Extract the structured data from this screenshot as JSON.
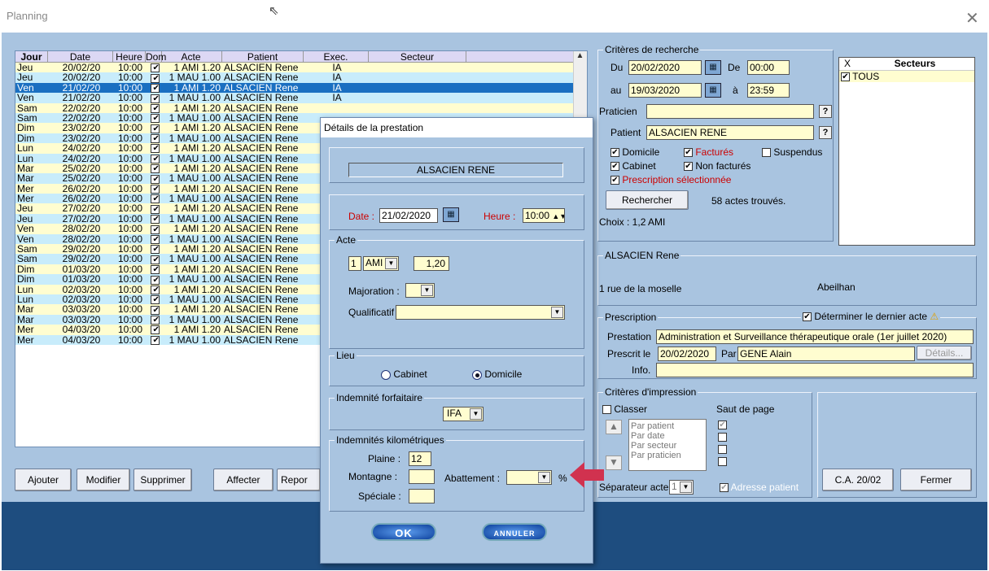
{
  "window": {
    "title": "Planning",
    "close_glyph": "✕"
  },
  "table": {
    "columns": [
      "Jour",
      "Date",
      "Heure",
      "Dom",
      "Acte",
      "Patient",
      "Exec.",
      "Secteur"
    ],
    "rows": [
      {
        "jour": "Jeu",
        "date": "20/02/20",
        "heure": "10:00",
        "dom": true,
        "acte": "1 AMI 1.20",
        "patient": "ALSACIEN Rene",
        "exec": "IA",
        "style": "yel"
      },
      {
        "jour": "Jeu",
        "date": "20/02/20",
        "heure": "10:00",
        "dom": true,
        "acte": "1 MAU 1.00",
        "patient": "ALSACIEN Rene",
        "exec": "IA",
        "style": "blu"
      },
      {
        "jour": "Ven",
        "date": "21/02/20",
        "heure": "10:00",
        "dom": true,
        "acte": "1 AMI 1.20",
        "patient": "ALSACIEN Rene",
        "exec": "IA",
        "style": "sel"
      },
      {
        "jour": "Ven",
        "date": "21/02/20",
        "heure": "10:00",
        "dom": true,
        "acte": "1 MAU 1.00",
        "patient": "ALSACIEN Rene",
        "exec": "IA",
        "style": "blu"
      },
      {
        "jour": "Sam",
        "date": "22/02/20",
        "heure": "10:00",
        "dom": true,
        "acte": "1 AMI 1.20",
        "patient": "ALSACIEN Rene",
        "exec": "",
        "style": "yel"
      },
      {
        "jour": "Sam",
        "date": "22/02/20",
        "heure": "10:00",
        "dom": true,
        "acte": "1 MAU 1.00",
        "patient": "ALSACIEN Rene",
        "exec": "",
        "style": "blu"
      },
      {
        "jour": "Dim",
        "date": "23/02/20",
        "heure": "10:00",
        "dom": true,
        "acte": "1 AMI 1.20",
        "patient": "ALSACIEN Rene",
        "exec": "",
        "style": "yel"
      },
      {
        "jour": "Dim",
        "date": "23/02/20",
        "heure": "10:00",
        "dom": true,
        "acte": "1 MAU 1.00",
        "patient": "ALSACIEN Rene",
        "exec": "",
        "style": "blu"
      },
      {
        "jour": "Lun",
        "date": "24/02/20",
        "heure": "10:00",
        "dom": true,
        "acte": "1 AMI 1.20",
        "patient": "ALSACIEN Rene",
        "exec": "",
        "style": "yel"
      },
      {
        "jour": "Lun",
        "date": "24/02/20",
        "heure": "10:00",
        "dom": true,
        "acte": "1 MAU 1.00",
        "patient": "ALSACIEN Rene",
        "exec": "",
        "style": "blu"
      },
      {
        "jour": "Mar",
        "date": "25/02/20",
        "heure": "10:00",
        "dom": true,
        "acte": "1 AMI 1.20",
        "patient": "ALSACIEN Rene",
        "exec": "",
        "style": "yel"
      },
      {
        "jour": "Mar",
        "date": "25/02/20",
        "heure": "10:00",
        "dom": true,
        "acte": "1 MAU 1.00",
        "patient": "ALSACIEN Rene",
        "exec": "",
        "style": "blu"
      },
      {
        "jour": "Mer",
        "date": "26/02/20",
        "heure": "10:00",
        "dom": true,
        "acte": "1 AMI 1.20",
        "patient": "ALSACIEN Rene",
        "exec": "",
        "style": "yel"
      },
      {
        "jour": "Mer",
        "date": "26/02/20",
        "heure": "10:00",
        "dom": true,
        "acte": "1 MAU 1.00",
        "patient": "ALSACIEN Rene",
        "exec": "",
        "style": "blu"
      },
      {
        "jour": "Jeu",
        "date": "27/02/20",
        "heure": "10:00",
        "dom": true,
        "acte": "1 AMI 1.20",
        "patient": "ALSACIEN Rene",
        "exec": "",
        "style": "yel"
      },
      {
        "jour": "Jeu",
        "date": "27/02/20",
        "heure": "10:00",
        "dom": true,
        "acte": "1 MAU 1.00",
        "patient": "ALSACIEN Rene",
        "exec": "",
        "style": "blu"
      },
      {
        "jour": "Ven",
        "date": "28/02/20",
        "heure": "10:00",
        "dom": true,
        "acte": "1 AMI 1.20",
        "patient": "ALSACIEN Rene",
        "exec": "",
        "style": "yel"
      },
      {
        "jour": "Ven",
        "date": "28/02/20",
        "heure": "10:00",
        "dom": true,
        "acte": "1 MAU 1.00",
        "patient": "ALSACIEN Rene",
        "exec": "",
        "style": "blu"
      },
      {
        "jour": "Sam",
        "date": "29/02/20",
        "heure": "10:00",
        "dom": true,
        "acte": "1 AMI 1.20",
        "patient": "ALSACIEN Rene",
        "exec": "",
        "style": "yel"
      },
      {
        "jour": "Sam",
        "date": "29/02/20",
        "heure": "10:00",
        "dom": true,
        "acte": "1 MAU 1.00",
        "patient": "ALSACIEN Rene",
        "exec": "",
        "style": "blu"
      },
      {
        "jour": "Dim",
        "date": "01/03/20",
        "heure": "10:00",
        "dom": true,
        "acte": "1 AMI 1.20",
        "patient": "ALSACIEN Rene",
        "exec": "",
        "style": "yel"
      },
      {
        "jour": "Dim",
        "date": "01/03/20",
        "heure": "10:00",
        "dom": true,
        "acte": "1 MAU 1.00",
        "patient": "ALSACIEN Rene",
        "exec": "",
        "style": "blu"
      },
      {
        "jour": "Lun",
        "date": "02/03/20",
        "heure": "10:00",
        "dom": true,
        "acte": "1 AMI 1.20",
        "patient": "ALSACIEN Rene",
        "exec": "",
        "style": "yel"
      },
      {
        "jour": "Lun",
        "date": "02/03/20",
        "heure": "10:00",
        "dom": true,
        "acte": "1 MAU 1.00",
        "patient": "ALSACIEN Rene",
        "exec": "",
        "style": "blu"
      },
      {
        "jour": "Mar",
        "date": "03/03/20",
        "heure": "10:00",
        "dom": true,
        "acte": "1 AMI 1.20",
        "patient": "ALSACIEN Rene",
        "exec": "",
        "style": "yel"
      },
      {
        "jour": "Mar",
        "date": "03/03/20",
        "heure": "10:00",
        "dom": true,
        "acte": "1 MAU 1.00",
        "patient": "ALSACIEN Rene",
        "exec": "",
        "style": "blu"
      },
      {
        "jour": "Mer",
        "date": "04/03/20",
        "heure": "10:00",
        "dom": true,
        "acte": "1 AMI 1.20",
        "patient": "ALSACIEN Rene",
        "exec": "",
        "style": "yel"
      },
      {
        "jour": "Mer",
        "date": "04/03/20",
        "heure": "10:00",
        "dom": true,
        "acte": "1 MAU 1.00",
        "patient": "ALSACIEN Rene",
        "exec": "",
        "style": "blu"
      }
    ]
  },
  "bottom_buttons": {
    "ajouter": "Ajouter",
    "modifier": "Modifier",
    "supprimer": "Supprimer",
    "affecter": "Affecter",
    "reporter": "Repor"
  },
  "criteria": {
    "legend": "Critères de recherche",
    "du_label": "Du",
    "du_value": "20/02/2020",
    "de_label": "De",
    "de_value": "00:00",
    "au_label": "au",
    "au_value": "19/03/2020",
    "a_label": "à",
    "a_value": "23:59",
    "praticien_label": "Praticien",
    "praticien_value": "",
    "patient_label": "Patient",
    "patient_value": "ALSACIEN RENE",
    "domicile": "Domicile",
    "factures": "Facturés",
    "suspendus": "Suspendus",
    "cabinet": "Cabinet",
    "non_factures": "Non facturés",
    "prescription_sel": "Prescription sélectionnée",
    "search_button": "Rechercher",
    "result": "58 actes trouvés.",
    "choix": "Choix : 1,2 AMI",
    "question": "?"
  },
  "secteurs": {
    "header_x": "X",
    "header": "Secteurs",
    "items": [
      "TOUS"
    ]
  },
  "patient_group": {
    "legend": "ALSACIEN Rene",
    "address": "1 rue de la moselle",
    "city": "Abeilhan"
  },
  "prescription": {
    "legend": "Prescription",
    "determiner": "Déterminer le dernier acte",
    "warn_icon": "⚠",
    "prestation_label": "Prestation",
    "prestation_value": "Administration et Surveillance thérapeutique orale (1er juillet 2020)",
    "prescrit_label": "Prescrit le",
    "prescrit_value": "20/02/2020",
    "par_label": "Par",
    "par_value": "GENE Alain",
    "details_button": "Détails...",
    "info_label": "Info.",
    "info_value": ""
  },
  "impression": {
    "legend": "Critères d'impression",
    "classer": "Classer",
    "saut": "Saut de page",
    "options": [
      "Par patient",
      "Par date",
      "Par secteur",
      "Par praticien"
    ],
    "separateur_label": "Séparateur acte",
    "separateur_value": "1",
    "adresse": "Adresse patient"
  },
  "right_buttons": {
    "ca": "C.A. 20/02",
    "fermer": "Fermer"
  },
  "dialog": {
    "title": "Détails de la prestation",
    "patient": "ALSACIEN RENE",
    "date_label": "Date :",
    "date_value": "21/02/2020",
    "heure_label": "Heure :",
    "heure_value": "10:00",
    "acte_legend": "Acte",
    "acte_qty": "1",
    "acte_code": "AMI",
    "acte_coef": "1,20",
    "majoration_label": "Majoration :",
    "majoration_value": "",
    "qualificatif_label": "Qualificatif",
    "qualificatif_value": "",
    "lieu_legend": "Lieu",
    "cabinet": "Cabinet",
    "domicile": "Domicile",
    "forfait_legend": "Indemnité forfaitaire",
    "forfait_value": "IFA",
    "km_legend": "Indemnités kilométriques",
    "plaine_label": "Plaine :",
    "plaine_value": "12",
    "montagne_label": "Montagne :",
    "montagne_value": "",
    "speciale_label": "Spéciale :",
    "speciale_value": "",
    "abattement_label": "Abattement :",
    "abattement_value": "",
    "percent": "%",
    "ok": "OK",
    "annuler": "ANNULER"
  }
}
